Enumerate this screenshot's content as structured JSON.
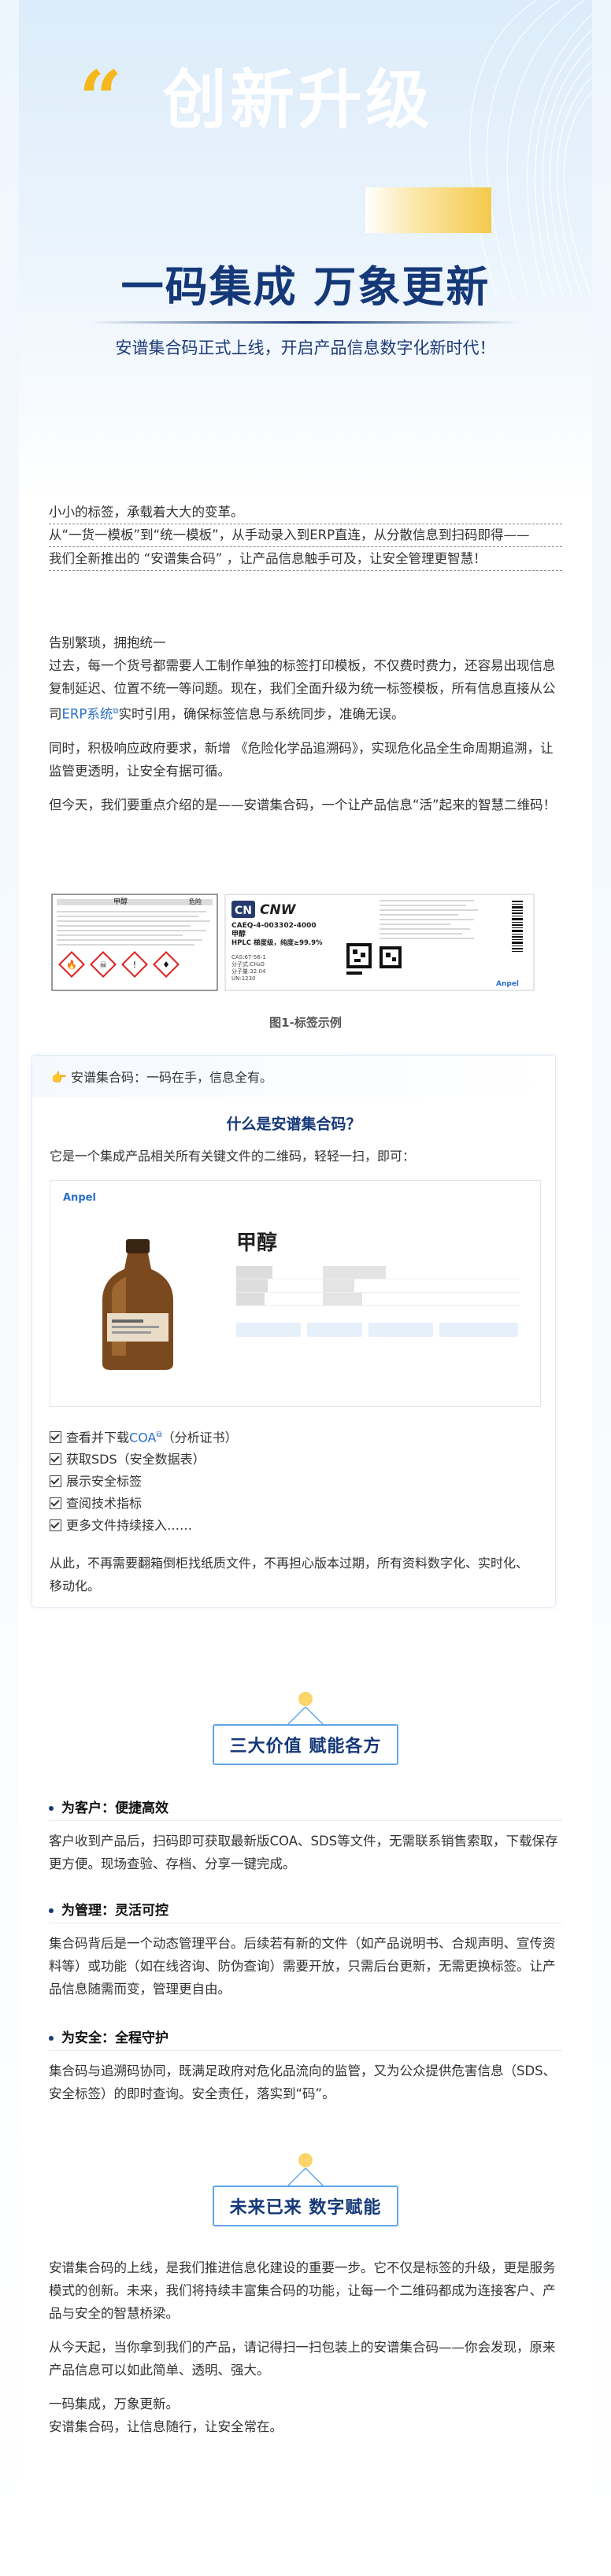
{
  "hero": {
    "quote": "“",
    "big_text": "创新升级",
    "title": "一码集成 万象更新",
    "subtitle": "安谱集合码正式上线，开启产品信息数字化新时代！"
  },
  "intro": {
    "line1": "小小的标签，承载着大大的变革。",
    "line2": "从“一货一模板”到“统一模板”，从手动录入到ERP直连，从分散信息到扫码即得——",
    "line3": "我们全新推出的 “安谱集合码” ，让产品信息触手可及，让安全管理更智慧！"
  },
  "para1": {
    "lead": "告别繁琐，拥抱统一",
    "text_a": "过去，每一个货号都需要人工制作单独的标签打印模板，不仅费时费力，还容易出现信息复制延迟、位置不统一等问题。现在，我们全面升级为统一标签模板，所有信息直接从公司",
    "link": "ERP系统",
    "text_b": "实时引用，确保标签信息与系统同步，准确无误。"
  },
  "para2": "同时，积极响应政府要求，新增 《危险化学品追溯码》，实现危化品全生命周期追溯，让监管更透明，让安全有据可循。",
  "para3": "但今天，我们要重点介绍的是——安谱集合码，一个让产品信息“活”起来的智慧二维码！",
  "label_figure": {
    "caption": "图1-标签示例",
    "left_label_title": "甲醇",
    "left_label_tag": "危险",
    "brand": "CNW",
    "product_code": "CAEQ-4-003302-4000",
    "product_name": "甲醇",
    "product_grade": "HPLC 梯度级，纯度≥99.9%",
    "cas": "CAS:67-56-1",
    "formula": "分子式:CH₄O",
    "mw": "分子量:32.04",
    "un": "UN:1230",
    "logo": "Anpel"
  },
  "what": {
    "bar_text": "安谱集合码：一码在手，信息全有。",
    "title": "什么是安谱集合码？",
    "desc": "它是一个集成产品相关所有关键文件的二维码，轻轻一扫，即可：",
    "screen_logo": "Anpel",
    "screen_title": "甲醇",
    "checklist": [
      {
        "pre": "查看并下载",
        "link": "COA",
        "post": "（分析证书）"
      },
      {
        "pre": "获取SDS（安全数据表）",
        "link": "",
        "post": ""
      },
      {
        "pre": "展示安全标签",
        "link": "",
        "post": ""
      },
      {
        "pre": "查阅技术指标",
        "link": "",
        "post": ""
      },
      {
        "pre": "更多文件持续接入……",
        "link": "",
        "post": ""
      }
    ],
    "closing": "从此，不再需要翻箱倒柜找纸质文件，不再担心版本过期，所有资料数字化、实时化、移动化。"
  },
  "values": {
    "title": "三大价值 赋能各方",
    "items": [
      {
        "head": "为客户：便捷高效",
        "text": "客户收到产品后，扫码即可获取最新版COA、SDS等文件，无需联系销售索取，下载保存更方便。现场查验、存档、分享一键完成。"
      },
      {
        "head": "为管理：灵活可控",
        "text": "集合码背后是一个动态管理平台。后续若有新的文件（如产品说明书、合规声明、宣传资料等）或功能（如在线咨询、防伪查询）需要开放，只需后台更新，无需更换标签。让产品信息随需而变，管理更自由。"
      },
      {
        "head": "为安全：全程守护",
        "text": "集合码与追溯码协同，既满足政府对危化品流向的监管，又为公众提供危害信息（SDS、安全标签）的即时查询。安全责任，落实到“码”。"
      }
    ]
  },
  "future": {
    "title": "未来已来 数字赋能",
    "p1": "安谱集合码的上线，是我们推进信息化建设的重要一步。它不仅是标签的升级，更是服务模式的创新。未来，我们将持续丰富集合码的功能，让每一个二维码都成为连接客户、产品与安全的智慧桥梁。",
    "p2": "从今天起，当你拿到我们的产品，请记得扫一扫包装上的安谱集合码——你会发现，原来产品信息可以如此简单、透明、强大。",
    "p3": "一码集成，万象更新。",
    "p4": "安谱集合码，让信息随行，让安全常在。"
  },
  "colors": {
    "navy": "#153878",
    "gold": "#f5b81c",
    "link": "#2c6fc9",
    "box_border": "#62a6e8"
  }
}
